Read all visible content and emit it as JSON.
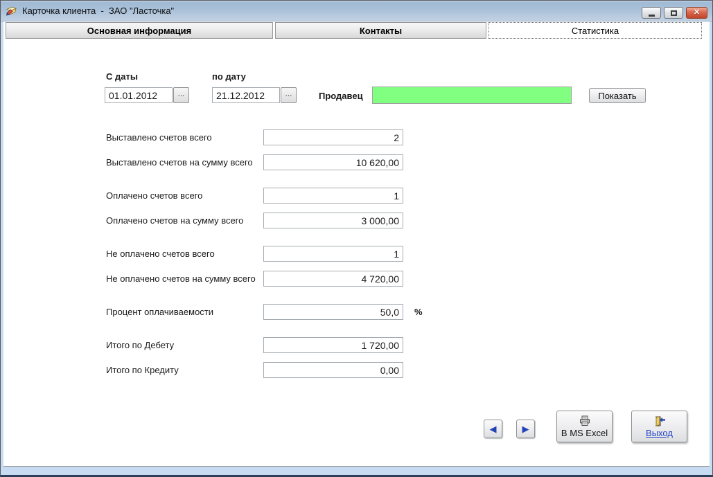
{
  "window": {
    "title": "Карточка клиента  -  ЗАО \"Ласточка\""
  },
  "tabs": [
    {
      "label": "Основная информация",
      "active": false
    },
    {
      "label": "Контакты",
      "active": false
    },
    {
      "label": "Статистика",
      "active": true
    }
  ],
  "filter": {
    "from_label": "С даты",
    "from_value": "01.01.2012",
    "to_label": "по дату",
    "to_value": "21.12.2012",
    "browse": "...",
    "seller_label": "Продавец",
    "seller_value": "",
    "seller_field_color": "#80FF80",
    "show_button": "Показать"
  },
  "stats": {
    "rows": [
      {
        "label": "Выставлено счетов всего",
        "value": "2"
      },
      {
        "label": "Выставлено счетов на сумму всего",
        "value": "10 620,00"
      },
      {
        "label": "Оплачено счетов всего",
        "value": "1"
      },
      {
        "label": "Оплачено счетов на сумму всего",
        "value": "3 000,00"
      },
      {
        "label": "Не оплачено счетов всего",
        "value": "1"
      },
      {
        "label": "Не оплачено счетов на сумму всего",
        "value": "4 720,00"
      },
      {
        "label": "Процент оплачиваемости",
        "value": "50,0",
        "suffix": "%"
      },
      {
        "label": "Итого по Дебету",
        "value": "1 720,00"
      },
      {
        "label": "Итого по Кредиту",
        "value": "0,00"
      }
    ]
  },
  "footer": {
    "prev_icon": "◀",
    "next_icon": "▶",
    "arrow_color": "#2343B5",
    "excel_button": "В MS Excel",
    "exit_button": "Выход",
    "exit_link_color": "#2143C7"
  }
}
